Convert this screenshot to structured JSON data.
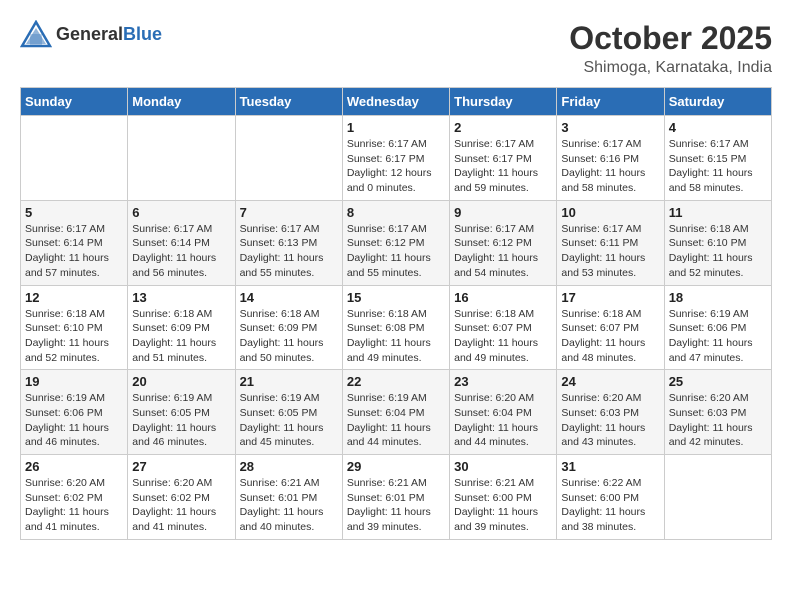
{
  "logo": {
    "general": "General",
    "blue": "Blue"
  },
  "title": {
    "month": "October 2025",
    "location": "Shimoga, Karnataka, India"
  },
  "weekdays": [
    "Sunday",
    "Monday",
    "Tuesday",
    "Wednesday",
    "Thursday",
    "Friday",
    "Saturday"
  ],
  "weeks": [
    [
      {
        "day": "",
        "info": ""
      },
      {
        "day": "",
        "info": ""
      },
      {
        "day": "",
        "info": ""
      },
      {
        "day": "1",
        "info": "Sunrise: 6:17 AM\nSunset: 6:17 PM\nDaylight: 12 hours\nand 0 minutes."
      },
      {
        "day": "2",
        "info": "Sunrise: 6:17 AM\nSunset: 6:17 PM\nDaylight: 11 hours\nand 59 minutes."
      },
      {
        "day": "3",
        "info": "Sunrise: 6:17 AM\nSunset: 6:16 PM\nDaylight: 11 hours\nand 58 minutes."
      },
      {
        "day": "4",
        "info": "Sunrise: 6:17 AM\nSunset: 6:15 PM\nDaylight: 11 hours\nand 58 minutes."
      }
    ],
    [
      {
        "day": "5",
        "info": "Sunrise: 6:17 AM\nSunset: 6:14 PM\nDaylight: 11 hours\nand 57 minutes."
      },
      {
        "day": "6",
        "info": "Sunrise: 6:17 AM\nSunset: 6:14 PM\nDaylight: 11 hours\nand 56 minutes."
      },
      {
        "day": "7",
        "info": "Sunrise: 6:17 AM\nSunset: 6:13 PM\nDaylight: 11 hours\nand 55 minutes."
      },
      {
        "day": "8",
        "info": "Sunrise: 6:17 AM\nSunset: 6:12 PM\nDaylight: 11 hours\nand 55 minutes."
      },
      {
        "day": "9",
        "info": "Sunrise: 6:17 AM\nSunset: 6:12 PM\nDaylight: 11 hours\nand 54 minutes."
      },
      {
        "day": "10",
        "info": "Sunrise: 6:17 AM\nSunset: 6:11 PM\nDaylight: 11 hours\nand 53 minutes."
      },
      {
        "day": "11",
        "info": "Sunrise: 6:18 AM\nSunset: 6:10 PM\nDaylight: 11 hours\nand 52 minutes."
      }
    ],
    [
      {
        "day": "12",
        "info": "Sunrise: 6:18 AM\nSunset: 6:10 PM\nDaylight: 11 hours\nand 52 minutes."
      },
      {
        "day": "13",
        "info": "Sunrise: 6:18 AM\nSunset: 6:09 PM\nDaylight: 11 hours\nand 51 minutes."
      },
      {
        "day": "14",
        "info": "Sunrise: 6:18 AM\nSunset: 6:09 PM\nDaylight: 11 hours\nand 50 minutes."
      },
      {
        "day": "15",
        "info": "Sunrise: 6:18 AM\nSunset: 6:08 PM\nDaylight: 11 hours\nand 49 minutes."
      },
      {
        "day": "16",
        "info": "Sunrise: 6:18 AM\nSunset: 6:07 PM\nDaylight: 11 hours\nand 49 minutes."
      },
      {
        "day": "17",
        "info": "Sunrise: 6:18 AM\nSunset: 6:07 PM\nDaylight: 11 hours\nand 48 minutes."
      },
      {
        "day": "18",
        "info": "Sunrise: 6:19 AM\nSunset: 6:06 PM\nDaylight: 11 hours\nand 47 minutes."
      }
    ],
    [
      {
        "day": "19",
        "info": "Sunrise: 6:19 AM\nSunset: 6:06 PM\nDaylight: 11 hours\nand 46 minutes."
      },
      {
        "day": "20",
        "info": "Sunrise: 6:19 AM\nSunset: 6:05 PM\nDaylight: 11 hours\nand 46 minutes."
      },
      {
        "day": "21",
        "info": "Sunrise: 6:19 AM\nSunset: 6:05 PM\nDaylight: 11 hours\nand 45 minutes."
      },
      {
        "day": "22",
        "info": "Sunrise: 6:19 AM\nSunset: 6:04 PM\nDaylight: 11 hours\nand 44 minutes."
      },
      {
        "day": "23",
        "info": "Sunrise: 6:20 AM\nSunset: 6:04 PM\nDaylight: 11 hours\nand 44 minutes."
      },
      {
        "day": "24",
        "info": "Sunrise: 6:20 AM\nSunset: 6:03 PM\nDaylight: 11 hours\nand 43 minutes."
      },
      {
        "day": "25",
        "info": "Sunrise: 6:20 AM\nSunset: 6:03 PM\nDaylight: 11 hours\nand 42 minutes."
      }
    ],
    [
      {
        "day": "26",
        "info": "Sunrise: 6:20 AM\nSunset: 6:02 PM\nDaylight: 11 hours\nand 41 minutes."
      },
      {
        "day": "27",
        "info": "Sunrise: 6:20 AM\nSunset: 6:02 PM\nDaylight: 11 hours\nand 41 minutes."
      },
      {
        "day": "28",
        "info": "Sunrise: 6:21 AM\nSunset: 6:01 PM\nDaylight: 11 hours\nand 40 minutes."
      },
      {
        "day": "29",
        "info": "Sunrise: 6:21 AM\nSunset: 6:01 PM\nDaylight: 11 hours\nand 39 minutes."
      },
      {
        "day": "30",
        "info": "Sunrise: 6:21 AM\nSunset: 6:00 PM\nDaylight: 11 hours\nand 39 minutes."
      },
      {
        "day": "31",
        "info": "Sunrise: 6:22 AM\nSunset: 6:00 PM\nDaylight: 11 hours\nand 38 minutes."
      },
      {
        "day": "",
        "info": ""
      }
    ]
  ]
}
